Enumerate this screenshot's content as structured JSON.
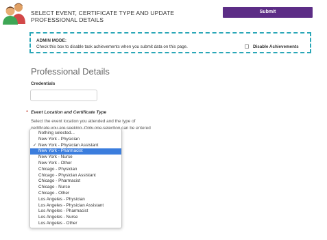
{
  "header": {
    "icon": "users-icon",
    "title": "SELECT EVENT, CERTIFICATE TYPE AND UPDATE PROFESSIONAL DETAILS",
    "submit_label": "Submit"
  },
  "admin": {
    "title": "ADMIN MODE:",
    "text": "Check this box to disable task achievements when you submit data on this page.",
    "checkbox_label": "Disable Achievements",
    "checked": false
  },
  "professional": {
    "heading": "Professional Details",
    "credentials_label": "Credentials",
    "credentials_value": ""
  },
  "event": {
    "label": "Event Location and Certificate Type",
    "help_line1": "Select the event location you attended and the type of",
    "help_line2": "certificate you are seeking. Only one selection can be entered",
    "options": [
      "Nothing selected...",
      "New York - Physician",
      "New York - Physician Assistant",
      "New York - Pharmacist",
      "New York - Nurse",
      "New York - Other",
      "Chicago - Physician",
      "Chicago - Physician Assistant",
      "Chicago - Pharmacist",
      "Chicago - Nurse",
      "Chicago - Other",
      "Los Angeles - Physician",
      "Los Angeles - Physician Assistant",
      "Los Angeles - Pharmacist",
      "Los Angeles - Nurse",
      "Los Angeles - Other"
    ],
    "checked_option": "New York - Physician Assistant",
    "highlighted_option": "New York - Pharmacist"
  },
  "colors": {
    "submit_bg": "#5c2d86",
    "admin_border": "#2aa7b7",
    "highlight": "#3b7ddd"
  }
}
